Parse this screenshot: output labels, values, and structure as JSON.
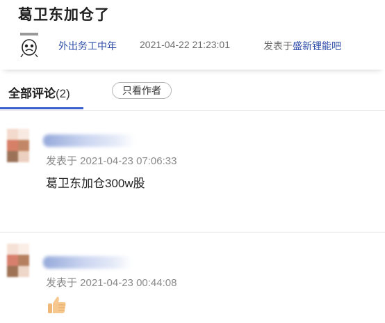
{
  "post": {
    "title": "葛卫东加仓了",
    "author": "外出务工中年",
    "time": "2021-04-22 21:23:01",
    "posted_in_prefix": "发表于",
    "forum": "盛新锂能吧"
  },
  "tabs": {
    "all_label": "全部评论",
    "all_count": "(2)",
    "only_author_label": "只看作者"
  },
  "comments": [
    {
      "time": "发表于 2021-04-23 07:06:33",
      "text": "葛卫东加仓300w股"
    },
    {
      "time": "发表于 2021-04-23 00:44:08",
      "emoji": "thumbs-up-icon"
    }
  ],
  "colors": {
    "link": "#2f4ea8",
    "tab_accent": "#3b5fcf",
    "meta_gray": "#6d6d6d"
  }
}
